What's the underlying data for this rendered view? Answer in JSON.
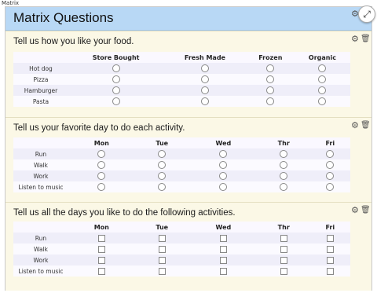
{
  "window_label": "Matrix",
  "title": "Matrix Questions",
  "questions": [
    {
      "title": "Tell us how you like your food.",
      "input_type": "radio",
      "columns": [
        "Store Bought",
        "Fresh Made",
        "Frozen",
        "Organic"
      ],
      "rows": [
        "Hot dog",
        "Pizza",
        "Hamburger",
        "Pasta"
      ]
    },
    {
      "title": "Tell us your favorite day to do each activity.",
      "input_type": "radio",
      "columns": [
        "Mon",
        "Tue",
        "Wed",
        "Thr",
        "Fri"
      ],
      "rows": [
        "Run",
        "Walk",
        "Work",
        "Listen to music"
      ]
    },
    {
      "title": "Tell us all the days you like to do the following activities.",
      "input_type": "checkbox",
      "columns": [
        "Mon",
        "Tue",
        "Wed",
        "Thr",
        "Fri"
      ],
      "rows": [
        "Run",
        "Walk",
        "Work",
        "Listen to music"
      ]
    }
  ],
  "icons": {
    "settings": "gear-icon",
    "delete": "trash-icon",
    "expand": "expand-icon"
  },
  "colors": {
    "title_bar": "#b8d8f5",
    "panel_bg": "#fbf8e6",
    "row_alt": "#efeef9"
  }
}
